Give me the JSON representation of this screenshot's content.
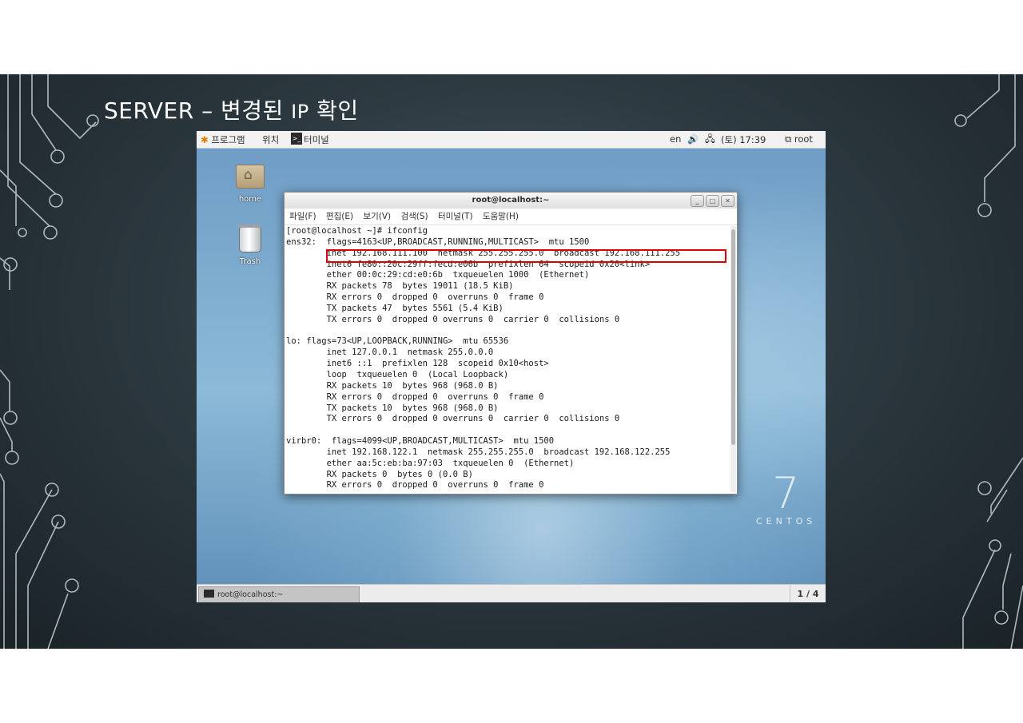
{
  "slide": {
    "title_prefix": "SERVER – 변경된 ",
    "title_ip": "IP",
    "title_suffix": " 확인"
  },
  "topbar": {
    "programs": "프로그램",
    "places": "위치",
    "terminal": "터미널",
    "lang": "en",
    "volume_icon": "🔊",
    "network_icon": "network-icon",
    "datetime": "(토) 17:39",
    "user": "root"
  },
  "desktop": {
    "icons": [
      {
        "label": "home"
      },
      {
        "label": "Trash"
      }
    ],
    "brand_number": "7",
    "brand_text": "CENTOS"
  },
  "terminal_window": {
    "title": "root@localhost:~",
    "menu": [
      "파일(F)",
      "편집(E)",
      "보기(V)",
      "검색(S)",
      "터미널(T)",
      "도움말(H)"
    ],
    "lines": [
      "[root@localhost ~]# ifconfig",
      "ens32:  flags=4163<UP,BROADCAST,RUNNING,MULTICAST>  mtu 1500",
      "        inet 192.168.111.100  netmask 255.255.255.0  broadcast 192.168.111.255",
      "        inet6 fe80::20c:29ff:fecd:e06b  prefixlen 64  scopeid 0x20<link>",
      "        ether 00:0c:29:cd:e0:6b  txqueuelen 1000  (Ethernet)",
      "        RX packets 78  bytes 19011 (18.5 KiB)",
      "        RX errors 0  dropped 0  overruns 0  frame 0",
      "        TX packets 47  bytes 5561 (5.4 KiB)",
      "        TX errors 0  dropped 0 overruns 0  carrier 0  collisions 0",
      "",
      "lo: flags=73<UP,LOOPBACK,RUNNING>  mtu 65536",
      "        inet 127.0.0.1  netmask 255.0.0.0",
      "        inet6 ::1  prefixlen 128  scopeid 0x10<host>",
      "        loop  txqueuelen 0  (Local Loopback)",
      "        RX packets 10  bytes 968 (968.0 B)",
      "        RX errors 0  dropped 0  overruns 0  frame 0",
      "        TX packets 10  bytes 968 (968.0 B)",
      "        TX errors 0  dropped 0 overruns 0  carrier 0  collisions 0",
      "",
      "virbr0:  flags=4099<UP,BROADCAST,MULTICAST>  mtu 1500",
      "        inet 192.168.122.1  netmask 255.255.255.0  broadcast 192.168.122.255",
      "        ether aa:5c:eb:ba:97:03  txqueuelen 0  (Ethernet)",
      "        RX packets 0  bytes 0 (0.0 B)",
      "        RX errors 0  dropped 0  overruns 0  frame 0"
    ]
  },
  "bottombar": {
    "task_label": "root@localhost:~",
    "workspace": "1 / 4"
  },
  "colors": {
    "highlight": "#e00000",
    "slide_bg": "#2d3a41"
  }
}
